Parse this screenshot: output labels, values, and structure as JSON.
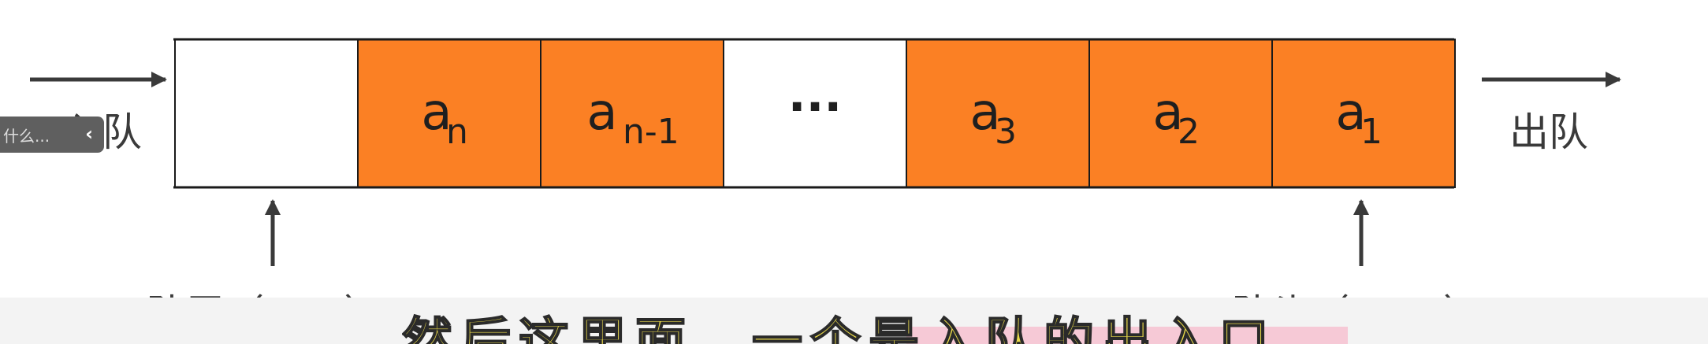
{
  "labels": {
    "enqueue": "入队",
    "dequeue": "出队",
    "rear": "队尾（rear）",
    "front": "队头（front）"
  },
  "cells": [
    {
      "kind": "empty",
      "base": "",
      "sub": ""
    },
    {
      "kind": "item",
      "base": "a",
      "sub": "n"
    },
    {
      "kind": "item",
      "base": "a",
      "sub": "n-1"
    },
    {
      "kind": "ellipsis",
      "base": "···",
      "sub": ""
    },
    {
      "kind": "item",
      "base": "a",
      "sub": "3"
    },
    {
      "kind": "item",
      "base": "a",
      "sub": "2"
    },
    {
      "kind": "item",
      "base": "a",
      "sub": "1"
    }
  ],
  "colors": {
    "filled": "#fb8024",
    "empty": "#ffffff",
    "line": "#1a1a1a",
    "arrow": "#3a3a3a",
    "overlay": "#5f5f5f",
    "subtitle_fill": "#e8d84a",
    "subtitle_band": "#f6c9d6"
  },
  "overlay": {
    "text": "什么...",
    "chevron": "‹"
  },
  "subtitle": {
    "text": "然后这里面，一个是入队的出入口"
  },
  "icons": {
    "enqueue_arrow": "arrow-right-icon",
    "dequeue_arrow": "arrow-right-icon",
    "rear_pointer": "arrow-up-icon",
    "front_pointer": "arrow-up-icon"
  }
}
